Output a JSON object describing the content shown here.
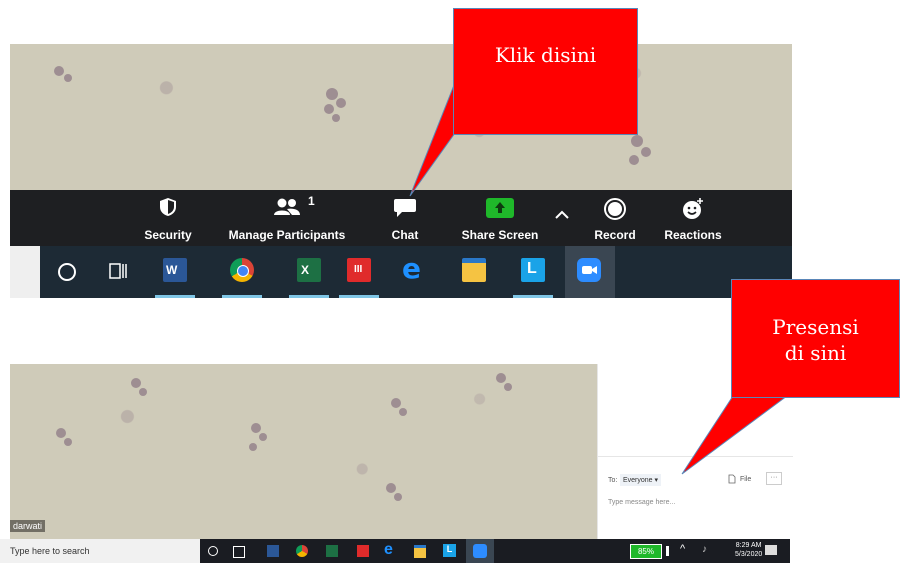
{
  "callouts": {
    "top": "Klik disini",
    "bottom_line1": "Presensi",
    "bottom_line2": "di sini"
  },
  "toolbar": {
    "security": "Security",
    "participants": "Manage Participants",
    "participants_count": "1",
    "chat": "Chat",
    "share": "Share Screen",
    "record": "Record",
    "reactions": "Reactions"
  },
  "chat": {
    "to_label": "To:",
    "to_value": "Everyone ▾",
    "file_label": "File",
    "more": "···",
    "placeholder": "Type message here..."
  },
  "video": {
    "name_tag": "darwati"
  },
  "taskbar2": {
    "search_placeholder": "Type here to search",
    "battery": "85%",
    "time": "8:29 AM",
    "date": "5/3/2020"
  },
  "colors": {
    "callout": "#ff0000",
    "share_green": "#1fb82a",
    "toolbar_bg": "#1e1f22",
    "zoom_blue": "#2d8cff"
  }
}
